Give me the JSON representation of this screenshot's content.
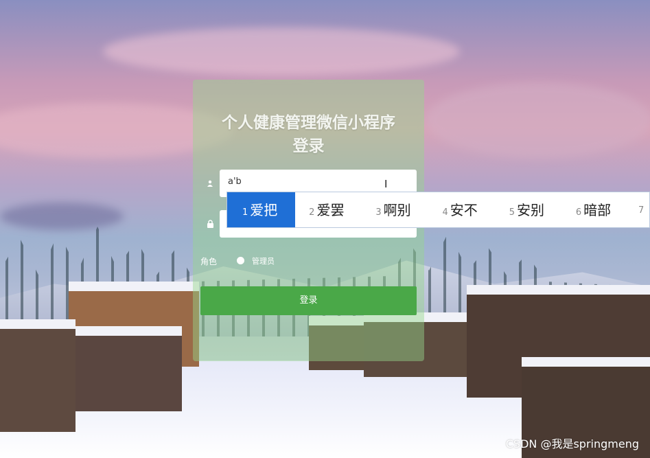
{
  "login": {
    "title_line1": "个人健康管理微信小程序",
    "title_line2": "登录",
    "username_value": "a'b",
    "role_label": "角色",
    "role_option": "管理员",
    "login_button": "登录"
  },
  "ime": {
    "candidates": [
      {
        "num": "1",
        "word": "爱把"
      },
      {
        "num": "2",
        "word": "爱罢"
      },
      {
        "num": "3",
        "word": "啊别"
      },
      {
        "num": "4",
        "word": "安不"
      },
      {
        "num": "5",
        "word": "安别"
      },
      {
        "num": "6",
        "word": "暗部"
      },
      {
        "num": "7",
        "word": ""
      }
    ]
  },
  "watermark": "CSDN @我是springmeng",
  "icons": [
    "user-icon",
    "lock-icon",
    "text-cursor-icon"
  ],
  "colors": {
    "primary_button": "#4aa848",
    "ime_selected": "#1f6fd6"
  }
}
